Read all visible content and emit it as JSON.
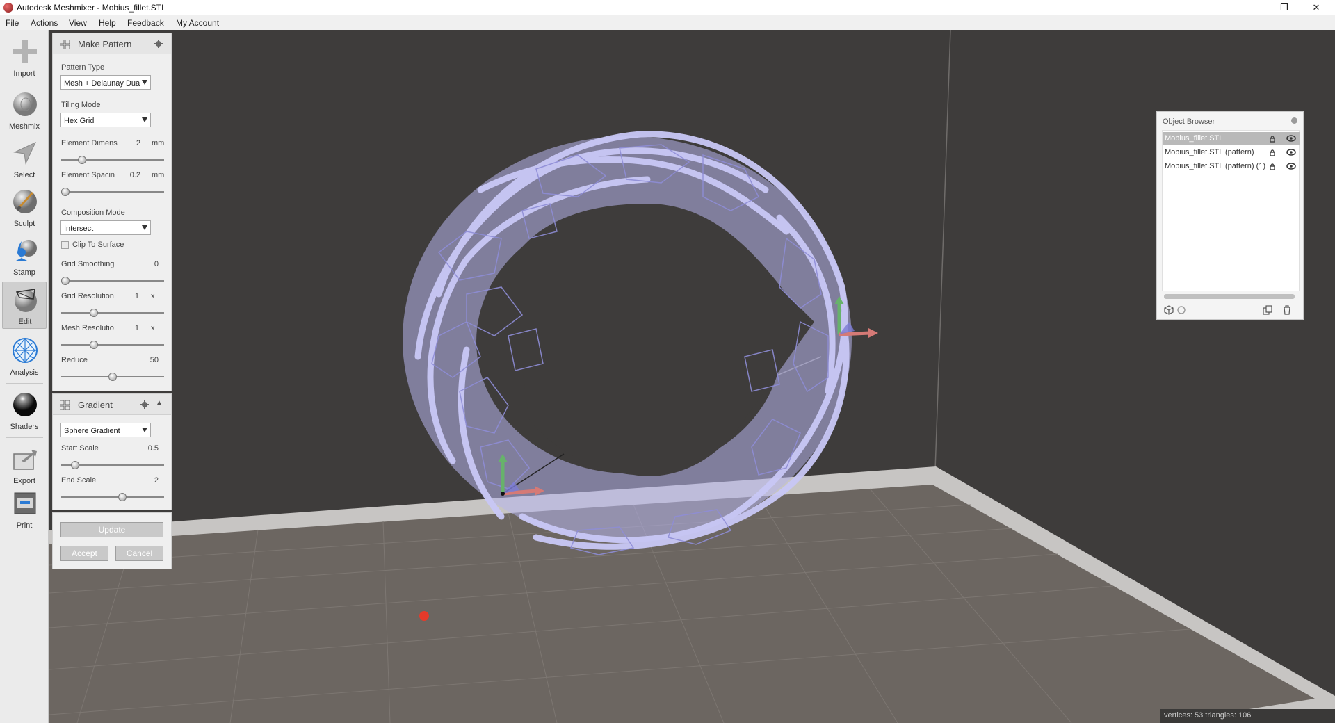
{
  "window": {
    "title": "Autodesk Meshmixer - Mobius_fillet.STL",
    "minimize": "—",
    "maximize": "❐",
    "close": "✕"
  },
  "menu": [
    "File",
    "Actions",
    "View",
    "Help",
    "Feedback",
    "My Account"
  ],
  "tools": [
    {
      "label": "Import",
      "icon": "plus-icon"
    },
    {
      "label": "Meshmix",
      "icon": "face-sphere-icon"
    },
    {
      "label": "Select",
      "icon": "arrow-cursor-icon"
    },
    {
      "label": "Sculpt",
      "icon": "brush-sphere-icon"
    },
    {
      "label": "Stamp",
      "icon": "fleur-de-lis-icon"
    },
    {
      "label": "Edit",
      "icon": "edit-sphere-icon"
    },
    {
      "label": "Analysis",
      "icon": "analysis-sphere-icon"
    },
    {
      "label": "Shaders",
      "icon": "shader-sphere-icon"
    },
    {
      "label": "Export",
      "icon": "export-folder-icon"
    },
    {
      "label": "Print",
      "icon": "printer-icon"
    }
  ],
  "make_pattern": {
    "title": "Make Pattern",
    "pattern_type_label": "Pattern Type",
    "pattern_type_value": "Mesh + Delaunay Dua",
    "tiling_mode_label": "Tiling Mode",
    "tiling_mode_value": "Hex Grid",
    "element_dimens_label": "Element Dimens",
    "element_dimens_value": "2",
    "element_dimens_unit": "mm",
    "element_dimens_level": 0.18,
    "element_spacing_label": "Element Spacin",
    "element_spacing_value": "0.2",
    "element_spacing_unit": "mm",
    "element_spacing_level": 0.0,
    "composition_mode_label": "Composition Mode",
    "composition_mode_value": "Intersect",
    "clip_to_surface_label": "Clip To Surface",
    "clip_to_surface_checked": false,
    "grid_smoothing_label": "Grid Smoothing",
    "grid_smoothing_value": "0",
    "grid_smoothing_level": 0.0,
    "grid_resolution_label": "Grid Resolution",
    "grid_resolution_value": "1",
    "grid_resolution_unit": "x",
    "grid_resolution_level": 0.3,
    "mesh_resolution_label": "Mesh Resolutio",
    "mesh_resolution_value": "1",
    "mesh_resolution_unit": "x",
    "mesh_resolution_level": 0.3,
    "reduce_label": "Reduce",
    "reduce_value": "50",
    "reduce_level": 0.5
  },
  "gradient": {
    "title": "Gradient",
    "collapse_glyph": "▲",
    "type_value": "Sphere Gradient",
    "start_scale_label": "Start Scale",
    "start_scale_value": "0.5",
    "start_scale_level": 0.1,
    "end_scale_label": "End Scale",
    "end_scale_value": "2",
    "end_scale_level": 0.6
  },
  "actions": {
    "update": "Update",
    "accept": "Accept",
    "cancel": "Cancel"
  },
  "object_browser": {
    "title": "Object Browser",
    "items": [
      {
        "name": "Mobius_fillet.STL",
        "selected": true
      },
      {
        "name": "Mobius_fillet.STL (pattern)",
        "selected": false
      },
      {
        "name": "Mobius_fillet.STL (pattern) (1)",
        "selected": false
      }
    ]
  },
  "status": "vertices: 53  triangles: 106",
  "colors": {
    "viewport_bg": "#3e3c3b",
    "floor": "#6b6560",
    "floor_border": "#c4c4c4",
    "mesh": "#b9b8ef",
    "mesh_edge": "#8c8bd0"
  }
}
